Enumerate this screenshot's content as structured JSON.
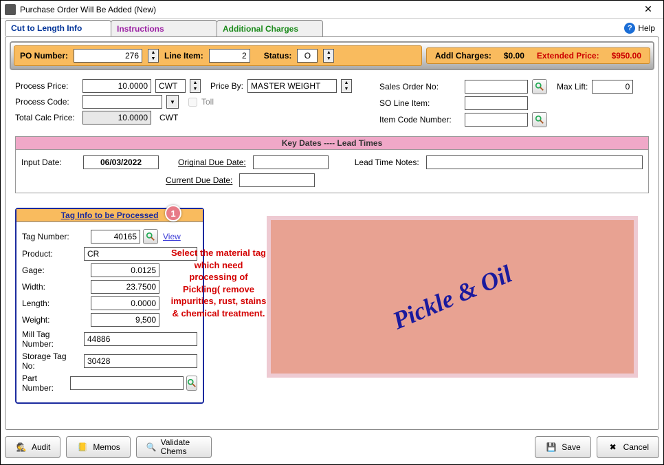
{
  "window": {
    "title": "Purchase Order Will Be Added  (New)"
  },
  "tabs": {
    "cut": "Cut to Length Info",
    "instructions": "Instructions",
    "charges": "Additional Charges"
  },
  "help": "Help",
  "orangebar": {
    "po_label": "PO Number:",
    "po_value": "276",
    "line_label": "Line Item:",
    "line_value": "2",
    "status_label": "Status:",
    "status_value": "O",
    "addl_label": "Addl Charges:",
    "addl_value": "$0.00",
    "ext_label": "Extended Price:",
    "ext_value": "$950.00"
  },
  "form": {
    "process_price_label": "Process Price:",
    "process_price": "10.0000",
    "process_price_unit": "CWT",
    "price_by_label": "Price By:",
    "price_by": "MASTER WEIGHT",
    "process_code_label": "Process Code:",
    "process_code": "",
    "toll_label": "Toll",
    "total_calc_label": "Total Calc Price:",
    "total_calc": "10.0000",
    "total_calc_unit": "CWT",
    "sales_order_label": "Sales Order No:",
    "sales_order": "",
    "maxlift_label": "Max Lift:",
    "maxlift": "0",
    "so_line_label": "SO Line Item:",
    "so_line": "",
    "item_code_label": "Item Code Number:",
    "item_code": ""
  },
  "keydates": {
    "header": "Key Dates ----  Lead Times",
    "input_date_label": "Input Date:",
    "input_date": "06/03/2022",
    "orig_due_label": "Original Due Date:",
    "orig_due": "",
    "curr_due_label": "Current Due Date:",
    "curr_due": "",
    "lead_notes_label": "Lead Time Notes:",
    "lead_notes": ""
  },
  "taginfo": {
    "header": "Tag Info to be Processed",
    "tag_no_label": "Tag Number:",
    "tag_no": "40165",
    "view": "View",
    "product_label": "Product:",
    "product": "CR",
    "gage_label": "Gage:",
    "gage": "0.0125",
    "width_label": "Width:",
    "width": "23.7500",
    "length_label": "Length:",
    "length": "0.0000",
    "weight_label": "Weight:",
    "weight": "9,500",
    "mill_tag_label": "Mill Tag Number:",
    "mill_tag": "44886",
    "storage_label": "Storage Tag No:",
    "storage": "30428",
    "part_no_label": "Part Number:",
    "part_no": ""
  },
  "callout": {
    "badge": "1",
    "text": "Select the material tag which need processing of Pickling( remove impurities, rust, stains & chemical treatment."
  },
  "pinkbox": "Pickle & Oil",
  "footer": {
    "audit": "Audit",
    "memos": "Memos",
    "validate": "Validate Chems",
    "save": "Save",
    "cancel": "Cancel"
  }
}
